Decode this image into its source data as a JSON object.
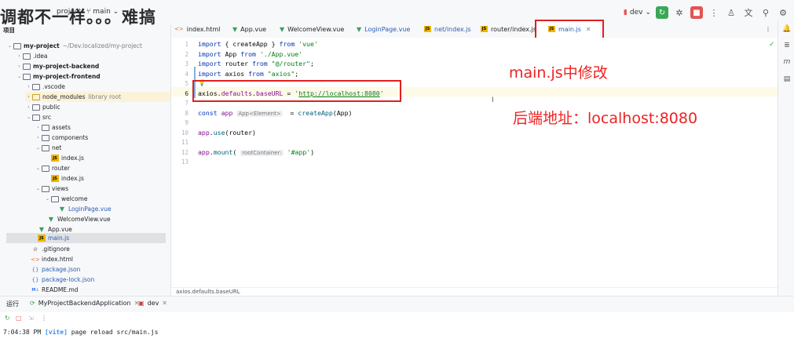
{
  "titlebar": {
    "overlay_text": "调都不一样。。。难搞",
    "project_label": "project",
    "branch": "main",
    "run_config": "dev",
    "colors": {
      "green": "#3aa755",
      "red": "#e55353"
    }
  },
  "project_panel": {
    "header": "项目",
    "items": [
      {
        "label": "my-project",
        "hint": "~/Dev.localized/my-project",
        "bold": true
      },
      {
        "label": ".idea"
      },
      {
        "label": "my-project-backend",
        "bold": true
      },
      {
        "label": "my-project-frontend",
        "bold": true
      },
      {
        "label": ".vscode"
      },
      {
        "label": "node_modules",
        "hint": "library root"
      },
      {
        "label": "public"
      },
      {
        "label": "src"
      },
      {
        "label": "assets"
      },
      {
        "label": "components"
      },
      {
        "label": "net"
      },
      {
        "label": "index.js"
      },
      {
        "label": "router"
      },
      {
        "label": "index.js"
      },
      {
        "label": "views"
      },
      {
        "label": "welcome"
      },
      {
        "label": "LoginPage.vue"
      },
      {
        "label": "WelcomeView.vue"
      },
      {
        "label": "App.vue"
      },
      {
        "label": "main.js"
      },
      {
        "label": ".gitignore"
      },
      {
        "label": "index.html"
      },
      {
        "label": "package.json"
      },
      {
        "label": "package-lock.json"
      },
      {
        "label": "README.md"
      }
    ]
  },
  "tabs": [
    {
      "label": "index.html"
    },
    {
      "label": "App.vue"
    },
    {
      "label": "WelcomeView.vue"
    },
    {
      "label": "LoginPage.vue"
    },
    {
      "label": "net/index.js"
    },
    {
      "label": "router/index.js"
    },
    {
      "label": "main.js",
      "active": true
    }
  ],
  "editor": {
    "line_numbers": [
      "1",
      "2",
      "3",
      "4",
      "5",
      "6",
      "7",
      "8",
      "9",
      "10",
      "11",
      "12",
      "13"
    ],
    "lines": {
      "l1": {
        "kw1": "import",
        "mid": " { createApp } ",
        "kw2": "from",
        "str": " 'vue'"
      },
      "l2": {
        "kw1": "import",
        "mid": " App ",
        "kw2": "from",
        "str": " './App.vue'"
      },
      "l3": {
        "kw1": "import",
        "mid": " router ",
        "kw2": "from",
        "str": " \"@/router\"",
        "end": ";"
      },
      "l4": {
        "kw1": "import",
        "mid": " axios ",
        "kw2": "from",
        "str": " \"axios\"",
        "end": ";"
      },
      "l6": {
        "obj": "axios",
        "dot": ".",
        "p1": "defaults",
        "dot2": ".",
        "p2": "baseURL",
        "eq": " = ",
        "q1": "'",
        "url": "http://localhost:8080",
        "q2": "'"
      },
      "l8": {
        "kw": "const",
        "name": " app ",
        "hint": "App<Element>",
        "rest": "  = ",
        "fn": "createApp",
        "args": "(App)"
      },
      "l10": {
        "obj": "app",
        "dot": ".",
        "fn": "use",
        "args": "(router)"
      },
      "l12": {
        "obj": "app",
        "dot": ".",
        "fn": "mount",
        "open": "( ",
        "hint": "rootContainer:",
        "str": " '#app'",
        "close": ")"
      }
    },
    "breadcrumb": "axios.defaults.baseURL"
  },
  "annotations": {
    "a1": "main.js中修改",
    "a2": "后端地址：localhost:8080",
    "color": "#ee2222"
  },
  "run_panel": {
    "label": "运行",
    "configs": [
      {
        "label": "MyProjectBackendApplication"
      },
      {
        "label": "dev"
      }
    ],
    "console_time": "7:04:38 PM",
    "console_tag": "[vite]",
    "console_msg": " page reload src/main.js"
  }
}
